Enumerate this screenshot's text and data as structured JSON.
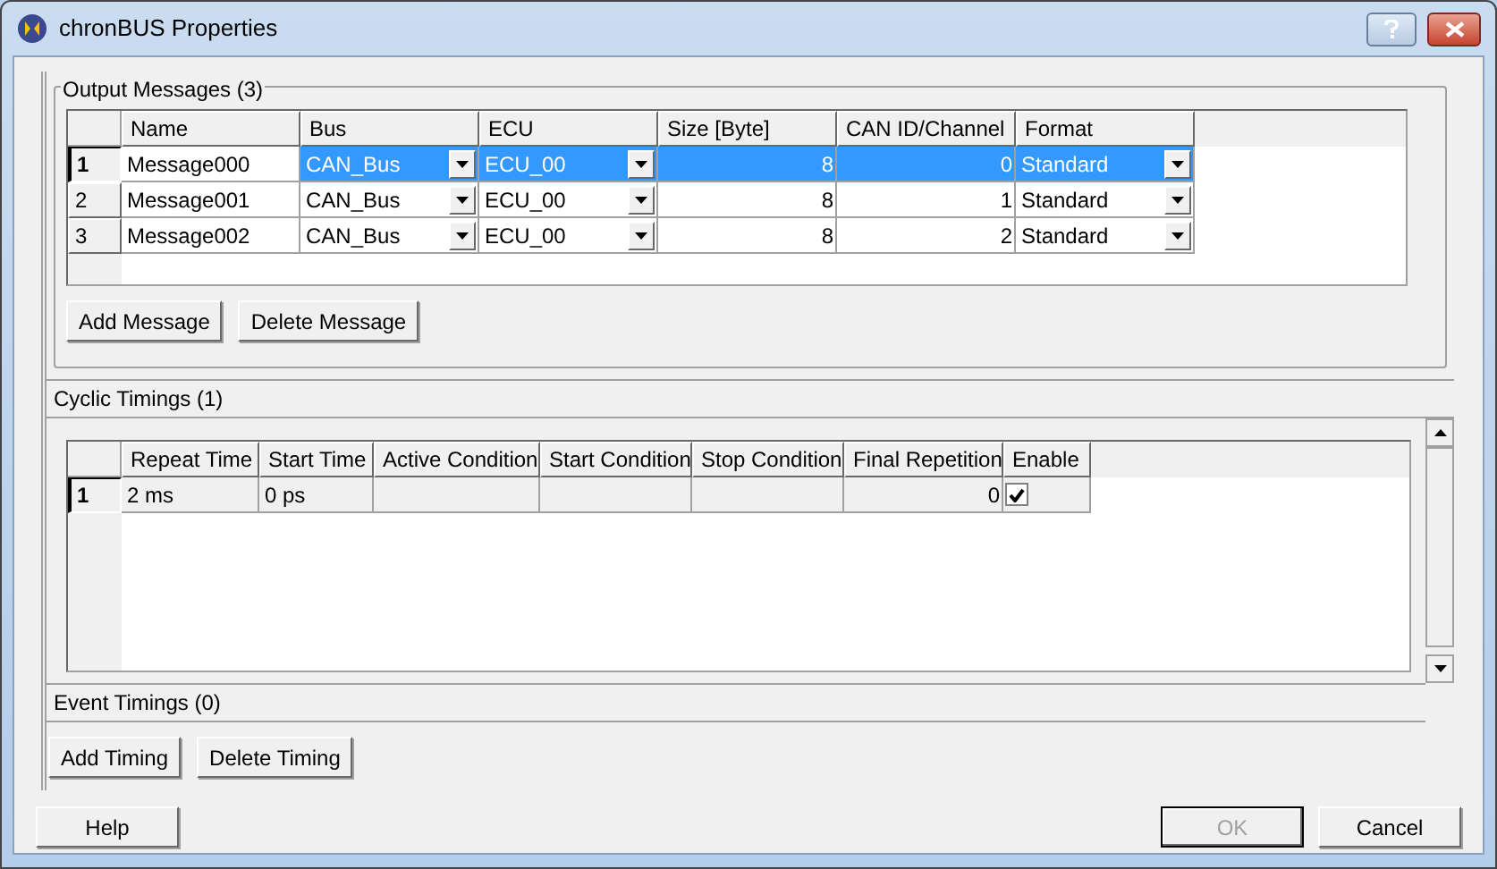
{
  "window": {
    "title": "chronBUS Properties"
  },
  "output_messages": {
    "title": "Output Messages (3)",
    "columns": [
      {
        "label": "Name",
        "kind": "text"
      },
      {
        "label": "Bus",
        "kind": "dropdown"
      },
      {
        "label": "ECU",
        "kind": "dropdown"
      },
      {
        "label": "Size [Byte]",
        "kind": "number"
      },
      {
        "label": "CAN ID/Channel",
        "kind": "number"
      },
      {
        "label": "Format",
        "kind": "dropdown"
      }
    ],
    "rows": [
      {
        "number": "1",
        "selected": true,
        "cells": [
          "Message000",
          "CAN_Bus",
          "ECU_00",
          "8",
          "0",
          "Standard"
        ]
      },
      {
        "number": "2",
        "selected": false,
        "cells": [
          "Message001",
          "CAN_Bus",
          "ECU_00",
          "8",
          "1",
          "Standard"
        ]
      },
      {
        "number": "3",
        "selected": false,
        "cells": [
          "Message002",
          "CAN_Bus",
          "ECU_00",
          "8",
          "2",
          "Standard"
        ]
      }
    ],
    "buttons": [
      "Add Message",
      "Delete Message"
    ]
  },
  "cyclic_timings": {
    "title": "Cyclic Timings (1)",
    "columns": [
      {
        "label": "Repeat Time",
        "kind": "text"
      },
      {
        "label": "Start Time",
        "kind": "text"
      },
      {
        "label": "Active Condition",
        "kind": "text"
      },
      {
        "label": "Start Condition",
        "kind": "text"
      },
      {
        "label": "Stop Condition",
        "kind": "text"
      },
      {
        "label": "Final Repetition",
        "kind": "number"
      },
      {
        "label": "Enable",
        "kind": "checkbox"
      }
    ],
    "rows": [
      {
        "number": "1",
        "selected": true,
        "cells": [
          "2 ms",
          "0 ps",
          null,
          null,
          null,
          "0",
          true
        ]
      }
    ]
  },
  "event_timings": {
    "title": "Event Timings (0)"
  },
  "timing_buttons": [
    "Add Timing",
    "Delete Timing"
  ],
  "dialog_buttons": [
    {
      "label": "Help",
      "disabled": false,
      "default": false
    },
    {
      "label": "OK",
      "disabled": true,
      "default": true
    },
    {
      "label": "Cancel",
      "disabled": false,
      "default": false
    }
  ]
}
